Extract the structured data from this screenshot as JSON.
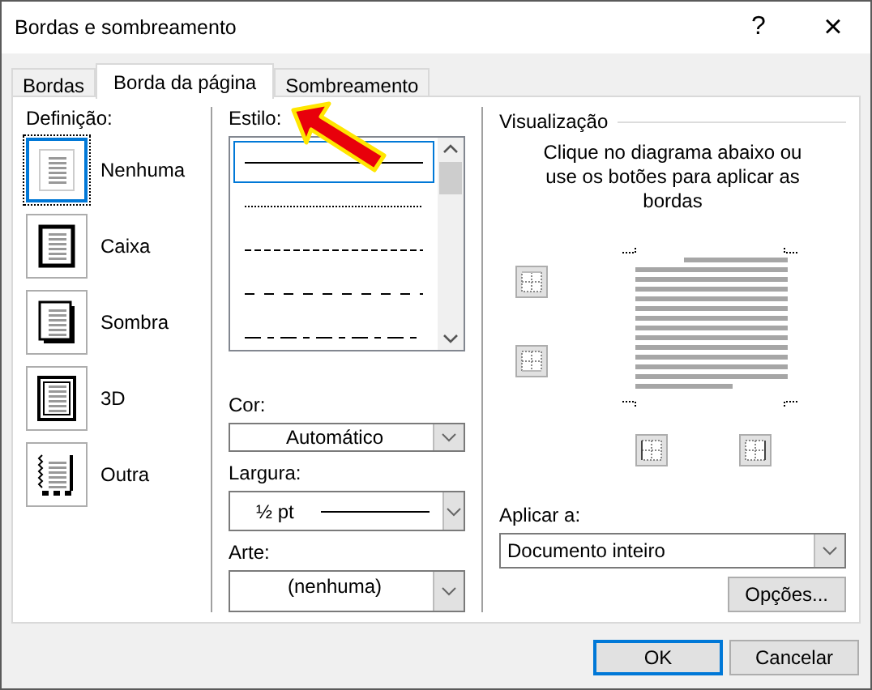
{
  "window": {
    "title": "Bordas e sombreamento",
    "help_button": "?",
    "close_button": "×"
  },
  "tabs": [
    {
      "label": "Bordas",
      "selected": false
    },
    {
      "label": "Borda da página",
      "selected": true
    },
    {
      "label": "Sombreamento",
      "selected": false
    }
  ],
  "setting": {
    "label": "Definição:",
    "options": [
      {
        "label": "Nenhuma",
        "kind": "none",
        "selected": true
      },
      {
        "label": "Caixa",
        "kind": "box",
        "selected": false
      },
      {
        "label": "Sombra",
        "kind": "shadow",
        "selected": false
      },
      {
        "label": "3D",
        "kind": "threed",
        "selected": false
      },
      {
        "label": "Outra",
        "kind": "custom",
        "selected": false
      }
    ]
  },
  "style": {
    "label": "Estilo:",
    "lines": [
      {
        "kind": "solid",
        "selected": true
      },
      {
        "kind": "dotted",
        "selected": false
      },
      {
        "kind": "dashed",
        "selected": false
      },
      {
        "kind": "dash",
        "selected": false
      },
      {
        "kind": "dashdot",
        "selected": false
      }
    ]
  },
  "color": {
    "label": "Cor:",
    "value": "Automático"
  },
  "width": {
    "label": "Largura:",
    "value": "½ pt"
  },
  "art": {
    "label": "Arte:",
    "value": "(nenhuma)"
  },
  "preview": {
    "label": "Visualização",
    "hint": "Clique no diagrama abaixo ou use os botões para aplicar as bordas",
    "edge_buttons": [
      {
        "kind": "top"
      },
      {
        "kind": "bottom"
      },
      {
        "kind": "left"
      },
      {
        "kind": "right"
      }
    ]
  },
  "apply_to": {
    "label": "Aplicar a:",
    "value": "Documento inteiro"
  },
  "options_button": "Opções...",
  "buttons": [
    {
      "label": "OK",
      "default": true
    },
    {
      "label": "Cancelar",
      "default": false
    }
  ]
}
